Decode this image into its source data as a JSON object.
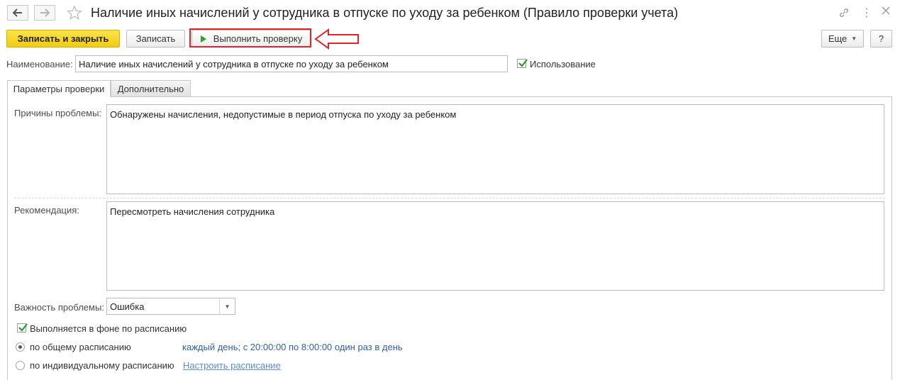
{
  "window": {
    "title": "Наличие иных начислений у сотрудника в отпуске по уходу за ребенком (Правило проверки учета)"
  },
  "toolbar": {
    "save_close_label": "Записать и закрыть",
    "save_label": "Записать",
    "run_check_label": "Выполнить проверку",
    "more_label": "Еще",
    "help_label": "?"
  },
  "form": {
    "name_label": "Наименование:",
    "name_value": "Наличие иных начислений у сотрудника в отпуске по уходу за ребенком",
    "usage_label": "Использование",
    "usage_checked": true
  },
  "tabs": [
    {
      "label": "Параметры проверки",
      "active": true
    },
    {
      "label": "Дополнительно",
      "active": false
    }
  ],
  "params": {
    "causes_label": "Причины проблемы:",
    "causes_value": "Обнаружены начисления, недопустимые в период отпуска по уходу за ребенком",
    "recommendation_label": "Рекомендация:",
    "recommendation_value": "Пересмотреть начисления сотрудника",
    "importance_label": "Важность проблемы:",
    "importance_value": "Ошибка",
    "background_label": "Выполняется в фоне по расписанию",
    "background_checked": true,
    "schedule_common_label": "по общему расписанию",
    "schedule_common_value": "каждый день; с 20:00:00 по 8:00:00 один раз в день",
    "schedule_individual_label": "по индивидуальному расписанию",
    "schedule_link": "Настроить расписание"
  },
  "colors": {
    "primary_button": "#f5d31f",
    "link": "#5a8ccf",
    "schedule_text": "#2f5fa8",
    "highlight": "#e0242a"
  }
}
